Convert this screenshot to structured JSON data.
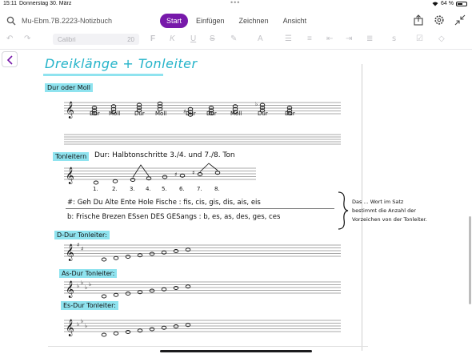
{
  "status": {
    "time": "15:11",
    "date": "Donnerstag 30. März",
    "battery": "64 %",
    "battery_level": 0.64
  },
  "titlebar": {
    "notebook": "Mu-Ebm.7B.2223-Notizbuch",
    "tabs": [
      "Start",
      "Einfügen",
      "Zeichnen",
      "Ansicht"
    ],
    "active_tab": "Start"
  },
  "ribbon": {
    "font": "Calibri",
    "size": "20"
  },
  "note": {
    "title": "Dreiklänge + Tonleiter",
    "section1": "Dur oder Moll",
    "chord_labels": [
      "Dur",
      "Moll",
      "Dur",
      "Moll",
      "Dur",
      "Dur",
      "Moll",
      "Dur",
      "Dur"
    ],
    "section2": "Tonleitern",
    "dur_rule": "Dur: Halbtonschritte 3./4. und 7./8. Ton",
    "scale_degrees": [
      "1.",
      "2.",
      "3.",
      "4.",
      "5.",
      "6.",
      "7.",
      "8."
    ],
    "sharp_row": "#: Geh Du Alte Ente Hole Fische : fis, cis, gis, dis, ais, eis",
    "flat_row": "b: Frische Brezen ESsen DES GESangs : b, es, as, des, ges, ces",
    "annotation": [
      "Das ... Wort im Satz",
      "bestimmt die Anzahl der",
      "Vorzeichen von der Tonleiter."
    ],
    "scale1": "D-Dur Tonleiter:",
    "scale2": "As-Dur Tonleiter:",
    "scale3": "Es-Dur Tonleiter:"
  }
}
